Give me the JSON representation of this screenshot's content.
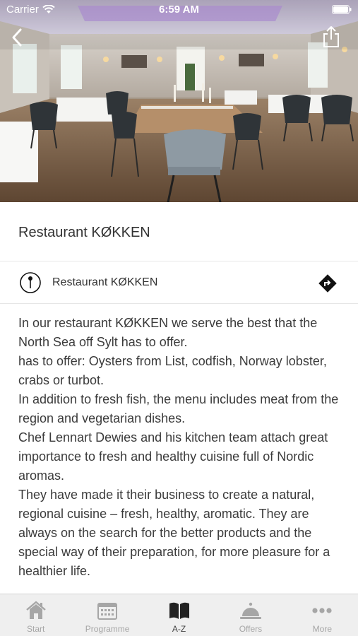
{
  "status_bar": {
    "carrier": "Carrier",
    "time": "6:59 AM"
  },
  "header": {
    "title": "Restaurant KØKKEN"
  },
  "location": {
    "name": "Restaurant KØKKEN"
  },
  "description": [
    "In our restaurant KØKKEN we serve the best that the North Sea off Sylt has to offer.",
    "has to offer: Oysters from List, codfish, Norway lobster, crabs or turbot.",
    "In addition to fresh fish, the menu includes meat from the region and vegetarian dishes.",
    "Chef Lennart Dewies and his kitchen team attach great importance to fresh and healthy cuisine full of Nordic aromas.",
    "They have made it their business to create a natural, regional cuisine – fresh, healthy, aromatic. They are always on the search for the better products and the special way of their preparation, for more pleasure for a healthier life."
  ],
  "tab_bar": {
    "items": [
      {
        "label": "Start",
        "icon": "home-icon",
        "active": false
      },
      {
        "label": "Programme",
        "icon": "calendar-icon",
        "active": false
      },
      {
        "label": "A-Z",
        "icon": "book-icon",
        "active": true
      },
      {
        "label": "Offers",
        "icon": "service-bell-icon",
        "active": false
      },
      {
        "label": "More",
        "icon": "more-icon",
        "active": false
      }
    ]
  },
  "colors": {
    "tab_active": "#444444",
    "tab_inactive": "#a6a6a6",
    "tab_bar_bg": "#efefef"
  }
}
